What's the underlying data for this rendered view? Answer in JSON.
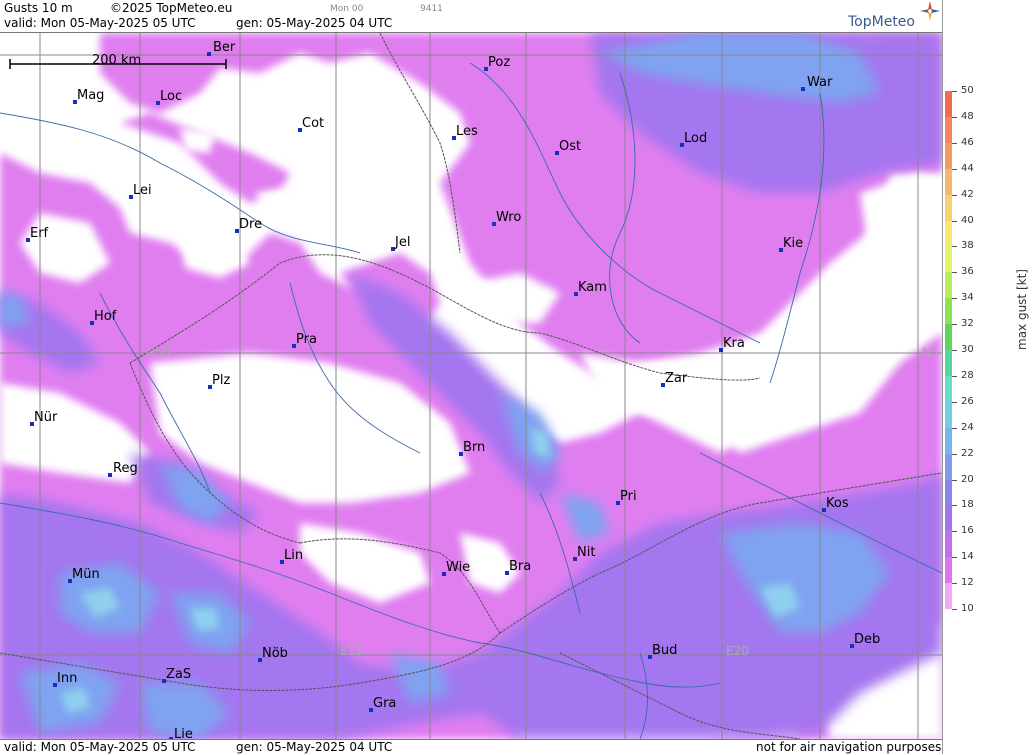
{
  "header": {
    "product": "Gusts 10 m",
    "copyright": "©2025 TopMeteo.eu",
    "run_tag": "Mon 00",
    "code": "9411",
    "valid": "valid:  Mon  05-May-2025  05 UTC",
    "gen": "gen: 05-May-2025 04 UTC",
    "logo": "TopMeteo"
  },
  "footer": {
    "valid": "valid:  Mon  05-May-2025  05 UTC",
    "gen": "gen: 05-May-2025 04 UTC",
    "notice": "not for air navigation purposes"
  },
  "map": {
    "scale_label": "200 km",
    "grid_labels": [
      "N50",
      "N5",
      "E15",
      "E20"
    ],
    "cities": [
      {
        "label": "Ber"
      },
      {
        "label": "Poz"
      },
      {
        "label": "War"
      },
      {
        "label": "Mag"
      },
      {
        "label": "Loc"
      },
      {
        "label": "Cot"
      },
      {
        "label": "Les"
      },
      {
        "label": "Ost"
      },
      {
        "label": "Lod"
      },
      {
        "label": "Lei"
      },
      {
        "label": "Erf"
      },
      {
        "label": "Dre"
      },
      {
        "label": "Wro"
      },
      {
        "label": "Jel"
      },
      {
        "label": "Kie"
      },
      {
        "label": "Kam"
      },
      {
        "label": "Hof"
      },
      {
        "label": "Pra"
      },
      {
        "label": "Kra"
      },
      {
        "label": "Plz"
      },
      {
        "label": "Zar"
      },
      {
        "label": "Nür"
      },
      {
        "label": "Brn"
      },
      {
        "label": "Reg"
      },
      {
        "label": "Pri"
      },
      {
        "label": "Kos"
      },
      {
        "label": "Lin"
      },
      {
        "label": "Nit"
      },
      {
        "label": "Mün"
      },
      {
        "label": "Wie"
      },
      {
        "label": "Bra"
      },
      {
        "label": "Deb"
      },
      {
        "label": "Nöb"
      },
      {
        "label": "Bud"
      },
      {
        "label": "Inn"
      },
      {
        "label": "ZaS"
      },
      {
        "label": "Gra"
      },
      {
        "label": "Lie"
      }
    ]
  },
  "legend": {
    "title": "max  gust  [kt]",
    "levels": [
      {
        "label": "50",
        "color": "#f26a4f"
      },
      {
        "label": "48",
        "color": "#f5845a"
      },
      {
        "label": "46",
        "color": "#f79a62"
      },
      {
        "label": "44",
        "color": "#f8b56b"
      },
      {
        "label": "42",
        "color": "#f8d070"
      },
      {
        "label": "40",
        "color": "#f4e86e"
      },
      {
        "label": "38",
        "color": "#e6f46a"
      },
      {
        "label": "36",
        "color": "#b8ee5c"
      },
      {
        "label": "34",
        "color": "#8ce452"
      },
      {
        "label": "32",
        "color": "#5fd85a"
      },
      {
        "label": "30",
        "color": "#55d89a"
      },
      {
        "label": "28",
        "color": "#68dcc8"
      },
      {
        "label": "26",
        "color": "#70cfe6"
      },
      {
        "label": "24",
        "color": "#75b6ee"
      },
      {
        "label": "22",
        "color": "#7d9cf0"
      },
      {
        "label": "20",
        "color": "#8a86f0"
      },
      {
        "label": "18",
        "color": "#a074ef"
      },
      {
        "label": "16",
        "color": "#c070ee"
      },
      {
        "label": "14",
        "color": "#de74ef"
      },
      {
        "label": "12",
        "color": "#f2a8f4"
      },
      {
        "label": "10",
        "color": "#ffffff"
      }
    ]
  }
}
